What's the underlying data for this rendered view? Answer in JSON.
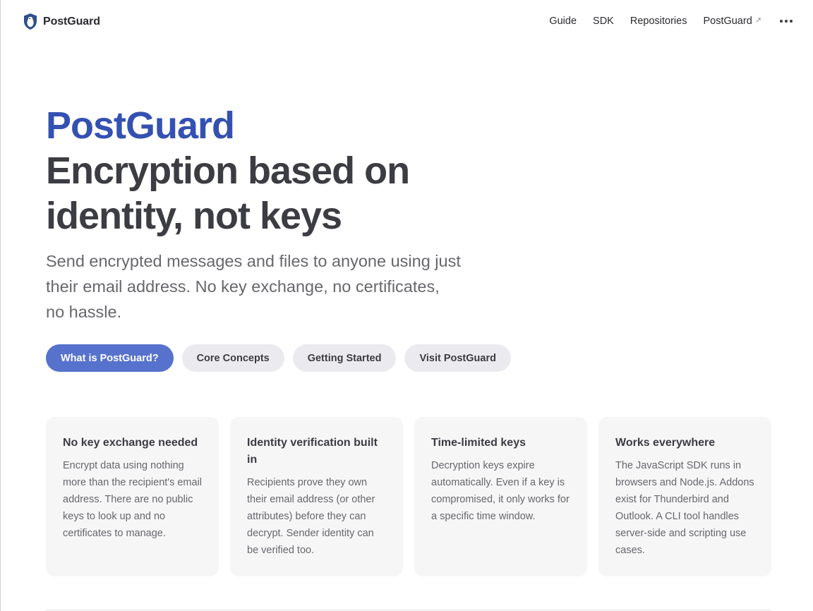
{
  "nav": {
    "brand": "PostGuard",
    "links": [
      "Guide",
      "SDK",
      "Repositories",
      "PostGuard"
    ],
    "external_icon": "↗",
    "more_icon": "more-horizontal-icon"
  },
  "hero": {
    "name": "PostGuard",
    "text_line1": "Encryption based on",
    "text_line2": "identity, not keys",
    "tagline": "Send encrypted messages and files to anyone using just their email address. No key exchange, no certificates, no hassle."
  },
  "actions": [
    "What is PostGuard?",
    "Core Concepts",
    "Getting Started",
    "Visit PostGuard"
  ],
  "features": [
    {
      "title": "No key exchange needed",
      "details": "Encrypt data using nothing more than the recipient's email address. There are no public keys to look up and no certificates to manage."
    },
    {
      "title": "Identity verification built in",
      "details": "Recipients prove they own their email address (or other attributes) before they can decrypt. Sender identity can be verified too."
    },
    {
      "title": "Time-limited keys",
      "details": "Decryption keys expire automatically. Even if a key is compromised, it only works for a specific time window."
    },
    {
      "title": "Works everywhere",
      "details": "The JavaScript SDK runs in browsers and Node.js. Addons exist for Thunderbird and Outlook. A CLI tool handles server-side and scripting use cases."
    }
  ],
  "colors": {
    "brand": "#3451b2",
    "button_brand": "#5672cd",
    "button_alt": "#ebebef",
    "card_bg": "#f6f6f7",
    "text": "#3c3c43",
    "text_muted": "#67676c"
  }
}
